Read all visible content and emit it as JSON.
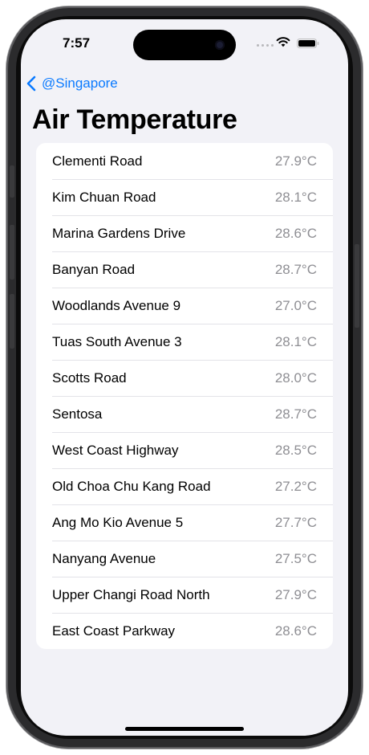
{
  "status_bar": {
    "time": "7:57",
    "icons": [
      "cellular-dots-icon",
      "wifi-icon",
      "battery-icon"
    ]
  },
  "navigation": {
    "back_label": "@Singapore",
    "accent_color": "#0a7aff"
  },
  "page": {
    "title": "Air Temperature"
  },
  "readings": [
    {
      "station": "Clementi Road",
      "temperature": "27.9°C"
    },
    {
      "station": "Kim Chuan Road",
      "temperature": "28.1°C"
    },
    {
      "station": "Marina Gardens Drive",
      "temperature": "28.6°C"
    },
    {
      "station": "Banyan Road",
      "temperature": "28.7°C"
    },
    {
      "station": "Woodlands Avenue 9",
      "temperature": "27.0°C"
    },
    {
      "station": "Tuas South Avenue 3",
      "temperature": "28.1°C"
    },
    {
      "station": "Scotts Road",
      "temperature": "28.0°C"
    },
    {
      "station": "Sentosa",
      "temperature": "28.7°C"
    },
    {
      "station": "West Coast Highway",
      "temperature": "28.5°C"
    },
    {
      "station": "Old Choa Chu Kang Road",
      "temperature": "27.2°C"
    },
    {
      "station": "Ang Mo Kio Avenue 5",
      "temperature": "27.7°C"
    },
    {
      "station": "Nanyang Avenue",
      "temperature": "27.5°C"
    },
    {
      "station": "Upper Changi Road North",
      "temperature": "27.9°C"
    },
    {
      "station": "East Coast Parkway",
      "temperature": "28.6°C"
    }
  ]
}
